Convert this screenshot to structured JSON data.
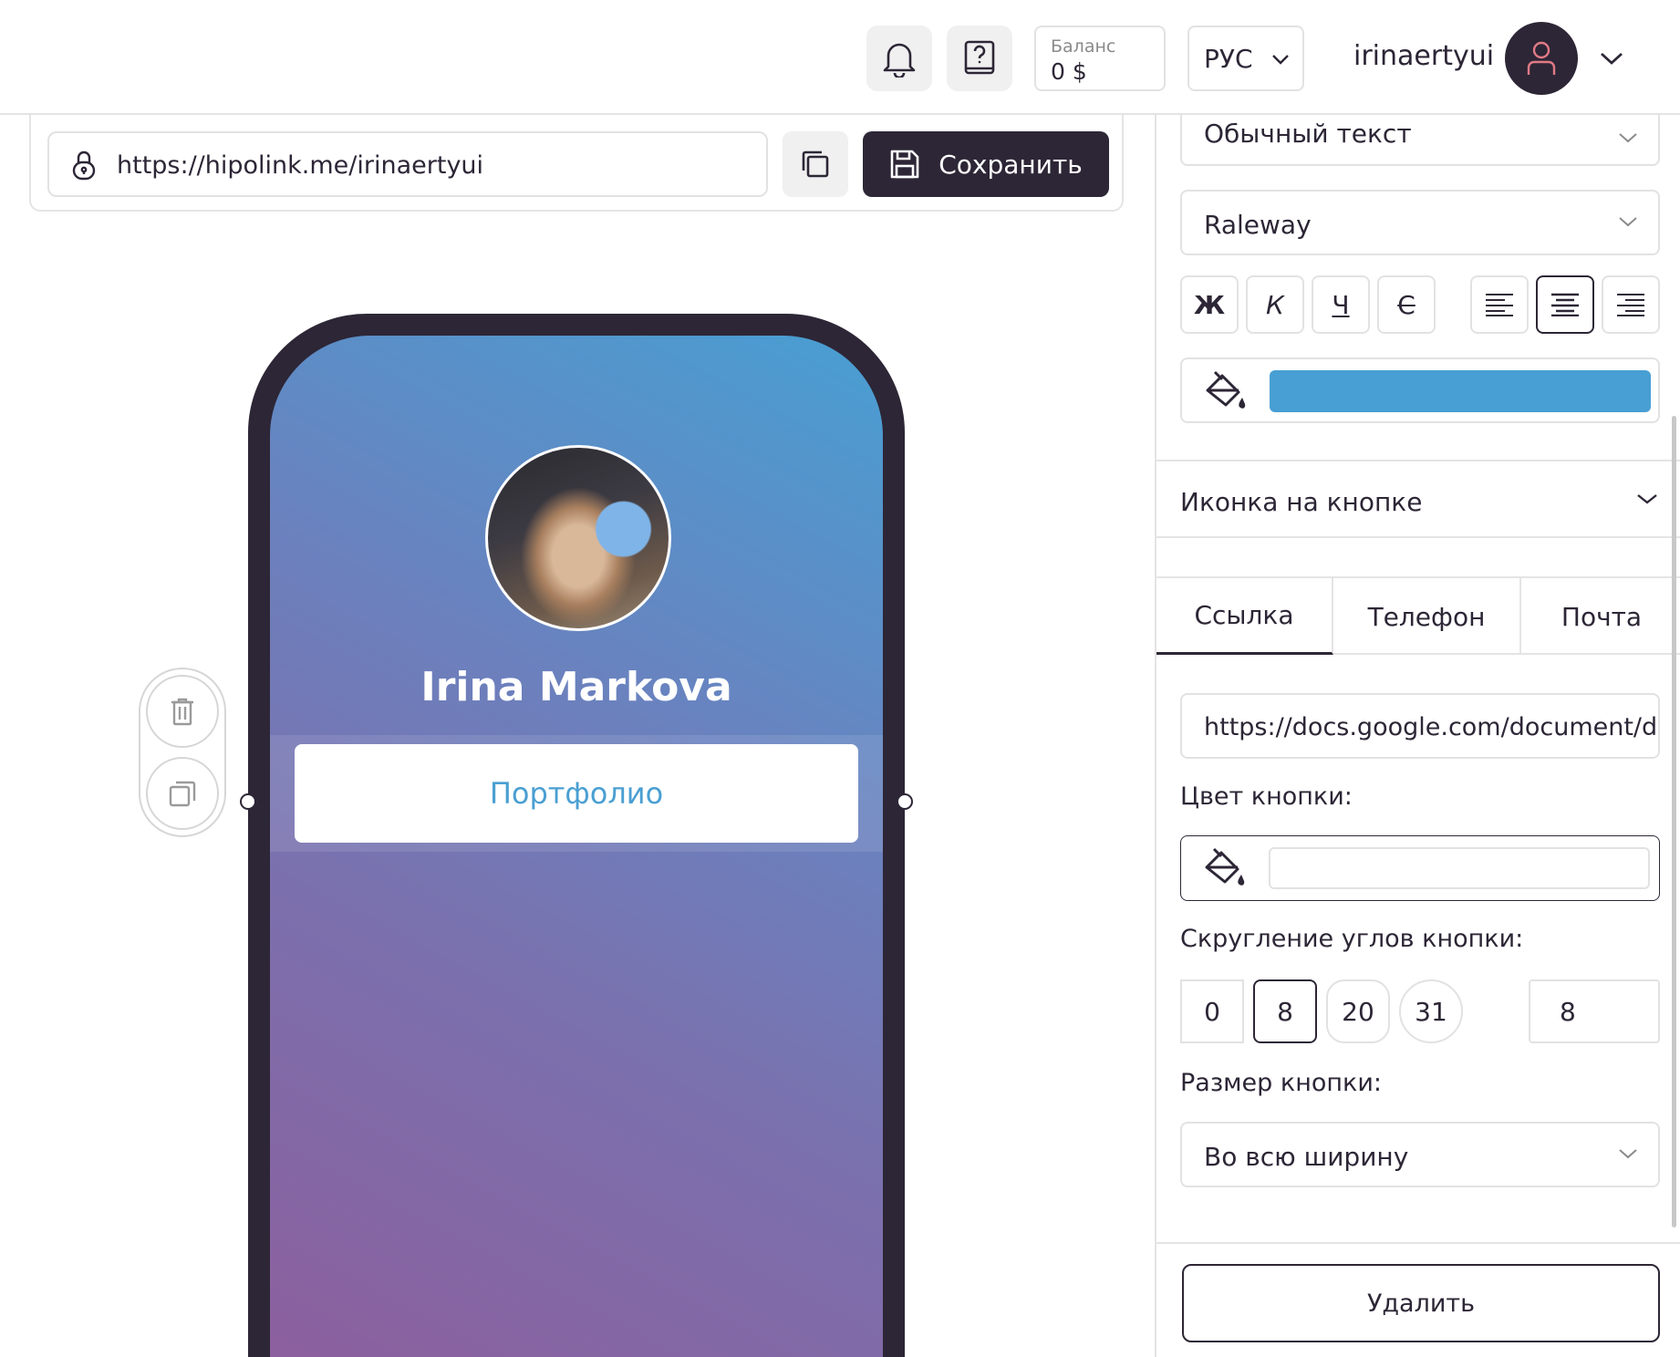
{
  "header": {
    "balance_label": "Баланс",
    "balance_value": "0 $",
    "language": "РУС",
    "username": "irinaertyui"
  },
  "editor": {
    "page_url": "https://hipolink.me/irinaertyui",
    "save_label": "Сохранить"
  },
  "preview": {
    "profile_name": "Irina Markova",
    "button_label": "Портфолио",
    "gradient_colors": [
      "#489fd3",
      "#6c80bd",
      "#8e5d9c"
    ]
  },
  "panel": {
    "text_style": "Обычный текст",
    "font_family": "Raleway",
    "format_buttons": {
      "bold": "Ж",
      "italic": "К",
      "underline": "Ч",
      "strike": "С"
    },
    "text_color": "#489fd3",
    "icon_section_label": "Иконка на кнопке",
    "tabs": [
      {
        "label": "Ссылка",
        "active": true
      },
      {
        "label": "Телефон",
        "active": false
      },
      {
        "label": "Почта",
        "active": false
      }
    ],
    "link_value": "https://docs.google.com/document/d",
    "button_color_label": "Цвет кнопки:",
    "button_color": "#ffffff",
    "radius_label": "Скругление углов кнопки:",
    "radius_options": [
      "0",
      "8",
      "20",
      "31"
    ],
    "radius_selected": "8",
    "radius_value": "8",
    "size_label": "Размер кнопки:",
    "size_value": "Во всю ширину",
    "delete_label": "Удалить"
  }
}
